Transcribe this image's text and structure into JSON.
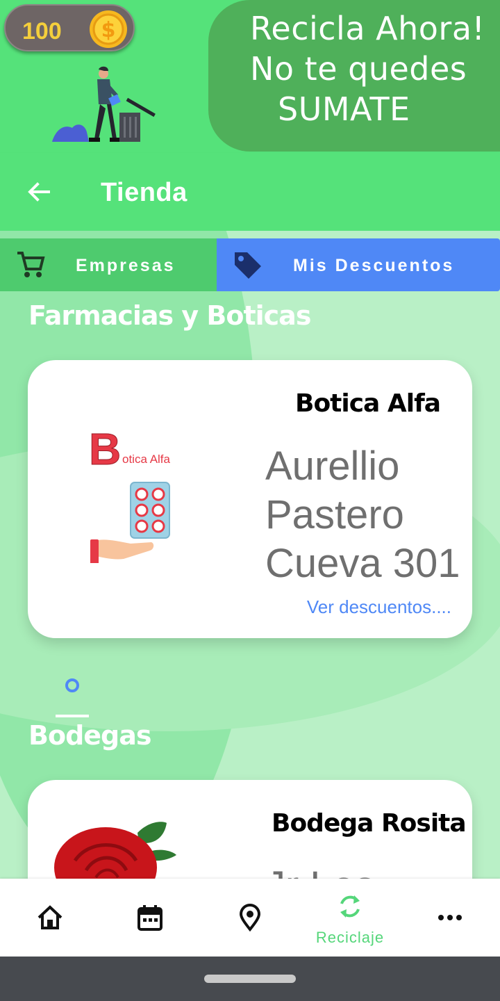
{
  "header": {
    "coins": "100",
    "slogan": [
      "Recicla Ahora!",
      "No te quedes",
      "SUMATE"
    ]
  },
  "appbar": {
    "title": "Tienda"
  },
  "tabs": [
    {
      "label": "Empresas",
      "icon": "cart-icon",
      "color": "#4ecb6e"
    },
    {
      "label": "Mis Descuentos",
      "icon": "tag-icon",
      "color": "#4f88f6",
      "selected": true
    }
  ],
  "sections": [
    {
      "title": "Farmacias y Boticas",
      "card": {
        "name": "Botica Alfa",
        "logo_text": "otica Alfa",
        "logo_initial": "B",
        "address": "Aurellio Pastero Cueva 301",
        "link": "Ver descuentos...."
      }
    },
    {
      "title": "Bodegas",
      "card": {
        "name": "Bodega Rosita",
        "address": "Jr Los"
      }
    }
  ],
  "bottom_nav": [
    {
      "icon": "home-icon"
    },
    {
      "icon": "calendar-icon"
    },
    {
      "icon": "location-pin-icon"
    },
    {
      "icon": "recycle-icon",
      "label": "Reciclaje",
      "active": true
    },
    {
      "icon": "more-icon"
    }
  ],
  "colors": {
    "primary_green": "#55e27a",
    "dark_green": "#4fb05a",
    "accent_blue": "#4f88f6",
    "background": "#b9f0c6"
  }
}
